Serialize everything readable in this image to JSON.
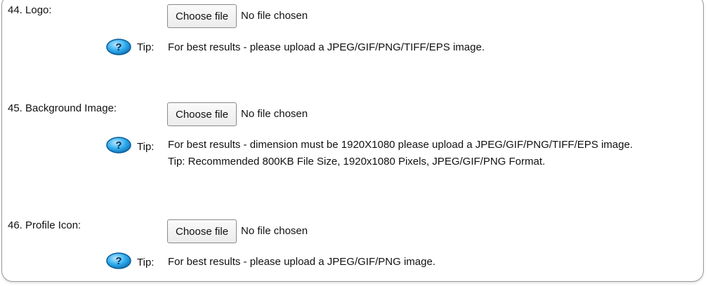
{
  "fields": [
    {
      "label": "44. Logo:",
      "button_label": "Choose file",
      "file_status": "No file chosen",
      "tip_label": "Tip:",
      "tip_lines": [
        "For best results - please upload a JPEG/GIF/PNG/TIFF/EPS image."
      ]
    },
    {
      "label": "45. Background Image:",
      "button_label": "Choose file",
      "file_status": "No file chosen",
      "tip_label": "Tip:",
      "tip_lines": [
        "For best results - dimension must be 1920X1080 please upload a JPEG/GIF/PNG/TIFF/EPS image.",
        "Tip: Recommended 800KB File Size, 1920x1080 Pixels, JPEG/GIF/PNG Format."
      ]
    },
    {
      "label": "46. Profile Icon:",
      "button_label": "Choose file",
      "file_status": "No file chosen",
      "tip_label": "Tip:",
      "tip_lines": [
        "For best results - please upload a JPEG/GIF/PNG image."
      ]
    }
  ],
  "icons": {
    "tip": "question-icon",
    "tip_color": "#2aa7e6"
  }
}
